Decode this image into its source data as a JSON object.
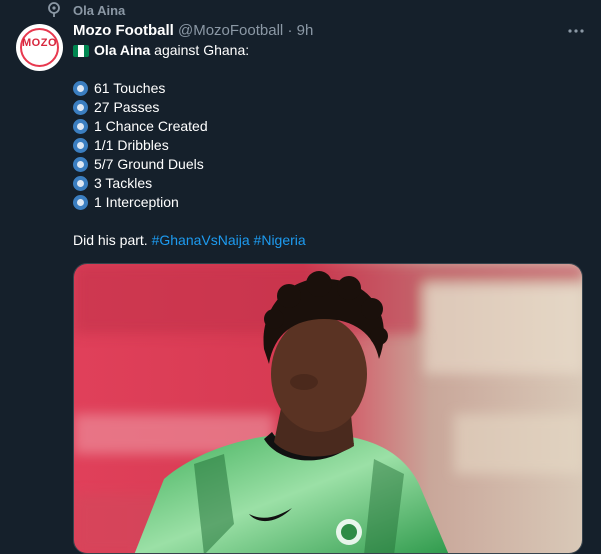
{
  "context": {
    "icon": "pin-icon",
    "label": "Ola Aina"
  },
  "author": {
    "avatar_text": "MOZO",
    "name": "Mozo Football",
    "handle": "@MozoFootball",
    "separator": "·",
    "time": "9h"
  },
  "tweet": {
    "intro_bold": "Ola Aina",
    "intro_rest": " against Ghana:",
    "stats": [
      "61 Touches",
      "27 Passes",
      "1 Chance Created",
      "1/1 Dribbles",
      "5/7 Ground Duels",
      "3 Tackles",
      "1 Interception"
    ],
    "closing_text": "Did his part. ",
    "hashtags": [
      "#GhanaVsNaija",
      "#Nigeria"
    ]
  },
  "colors": {
    "background": "#15202b",
    "secondary_text": "#8b98a5",
    "link": "#1d9bf0",
    "flag_green": "#008751",
    "bullet_blue": "#3b7ec0"
  },
  "icons": {
    "more": "more-dots-icon",
    "bullet": "blue-circle-icon",
    "flag": "nigeria-flag-icon"
  }
}
